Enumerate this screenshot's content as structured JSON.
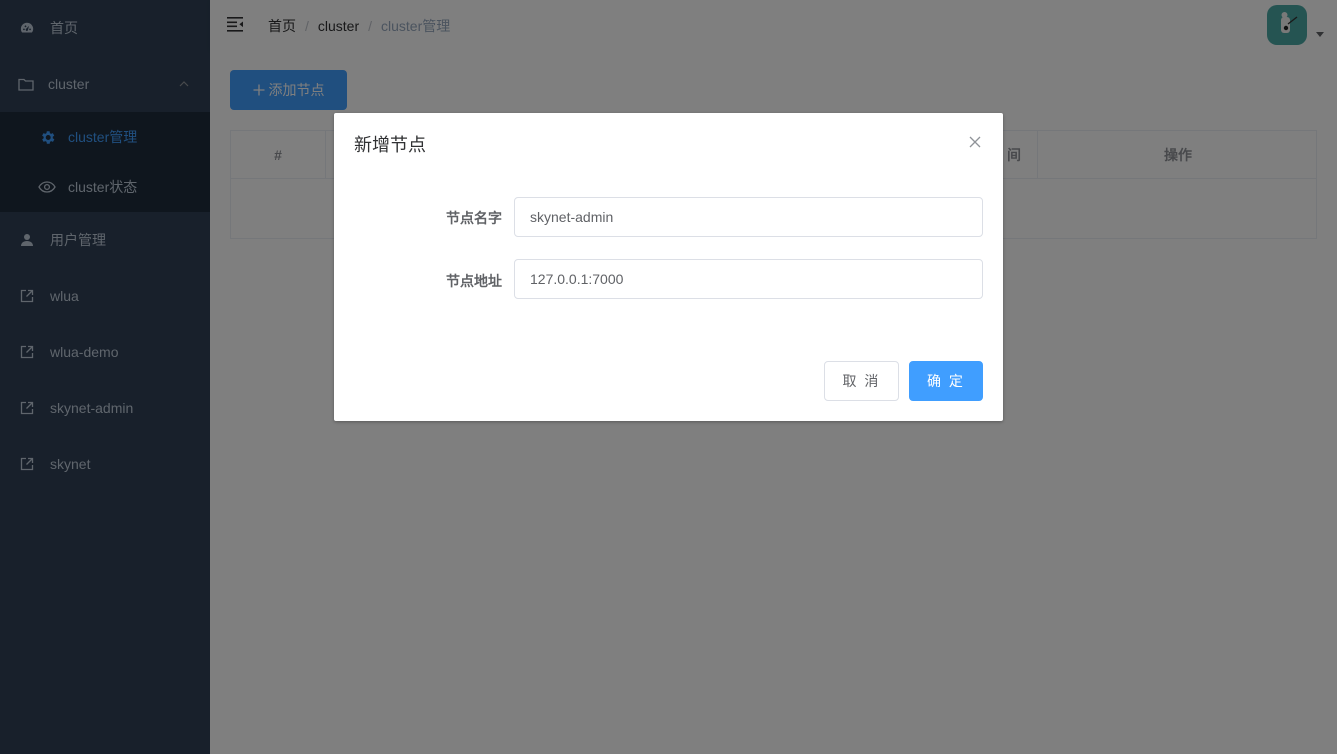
{
  "sidebar": {
    "items": [
      {
        "label": "首页",
        "icon": "dashboard-icon"
      },
      {
        "label": "cluster",
        "icon": "folder-icon",
        "expanded": true
      },
      {
        "label": "用户管理",
        "icon": "user-icon"
      },
      {
        "label": "wlua",
        "icon": "external-link-icon"
      },
      {
        "label": "wlua-demo",
        "icon": "external-link-icon"
      },
      {
        "label": "skynet-admin",
        "icon": "external-link-icon"
      },
      {
        "label": "skynet",
        "icon": "external-link-icon"
      }
    ],
    "cluster_children": [
      {
        "label": "cluster管理",
        "icon": "gear-icon",
        "active": true
      },
      {
        "label": "cluster状态",
        "icon": "eye-icon",
        "active": false
      }
    ]
  },
  "header": {
    "breadcrumb": [
      "首页",
      "cluster",
      "cluster管理"
    ]
  },
  "main": {
    "add_button_label": "添加节点",
    "add_button_icon": "plus-icon",
    "table": {
      "columns": [
        "#",
        "",
        "",
        "",
        "间",
        "操作"
      ]
    }
  },
  "dialog": {
    "title": "新增节点",
    "fields": [
      {
        "label": "节点名字",
        "value": "skynet-admin"
      },
      {
        "label": "节点地址",
        "value": "127.0.0.1:7000"
      }
    ],
    "cancel_label": "取 消",
    "confirm_label": "确 定"
  },
  "colors": {
    "sidebar_bg": "#304156",
    "submenu_bg": "#1f2d3d",
    "primary": "#409eff",
    "menu_text": "#bfcbd9",
    "avatar_bg": "#4aa8a4"
  }
}
